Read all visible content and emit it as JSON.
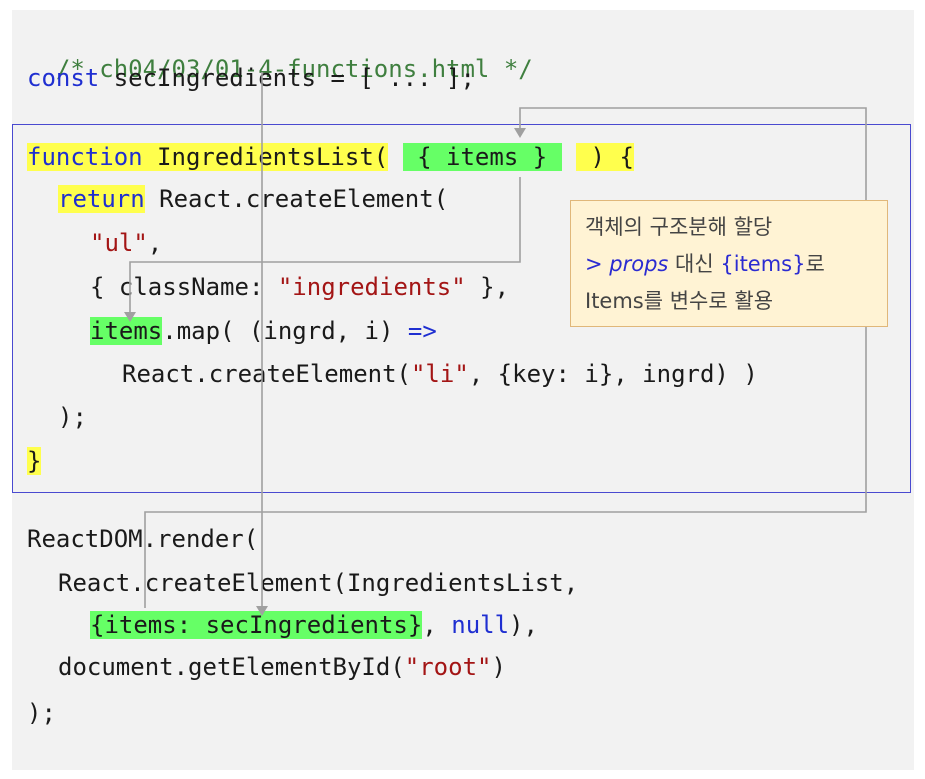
{
  "code": {
    "comment": "/* ch04/03/01-4-functions.html */",
    "line2": {
      "kw": "const",
      "rest": " secIngredients = [ ... ];"
    },
    "fn_line": {
      "kw": "function",
      "name": " IngredientsList(",
      "param": " { items } ",
      "close": " ) {"
    },
    "return_line": {
      "kw": "return",
      "rest": " React.createElement("
    },
    "ul_line": {
      "str": "\"ul\"",
      "rest": ","
    },
    "class_line": {
      "pre": "{ className: ",
      "str": "\"ingredients\"",
      "post": " },"
    },
    "map_line": {
      "hl": "items",
      "rest": ".map( (ingrd, i) ",
      "arrow": "=>"
    },
    "li_line": {
      "pre": "React.createElement(",
      "str": "\"li\"",
      "post": ", {key: i}, ingrd) )"
    },
    "close_paren": ");",
    "close_brace": "}",
    "render_line": "ReactDOM.render(",
    "create_line": "React.createElement(IngredientsList,",
    "items_line": {
      "hl": "{items: secIngredients}",
      "mid": ", ",
      "kw": "null",
      "post": "),"
    },
    "doc_line": {
      "pre": "document.getElementById(",
      "str": "\"root\"",
      "post": ")"
    },
    "end_line": ");"
  },
  "note": {
    "line1": "객체의 구조분해 할당",
    "line2_prefix": "> ",
    "line2_italic": "props",
    "line2_mid": " 대신 ",
    "line2_code": "{items}",
    "line2_suffix": "로",
    "line3": "Items를 변수로 활용"
  },
  "colors": {
    "keyword": "#1f2fd1",
    "string": "#a31515",
    "comment": "#3f7f3f",
    "highlight_yellow": "#ffff4d",
    "highlight_green": "#66ff66",
    "box_border": "#4a4ad0",
    "note_bg": "#fff3d4",
    "arrow": "#a0a0a0"
  }
}
